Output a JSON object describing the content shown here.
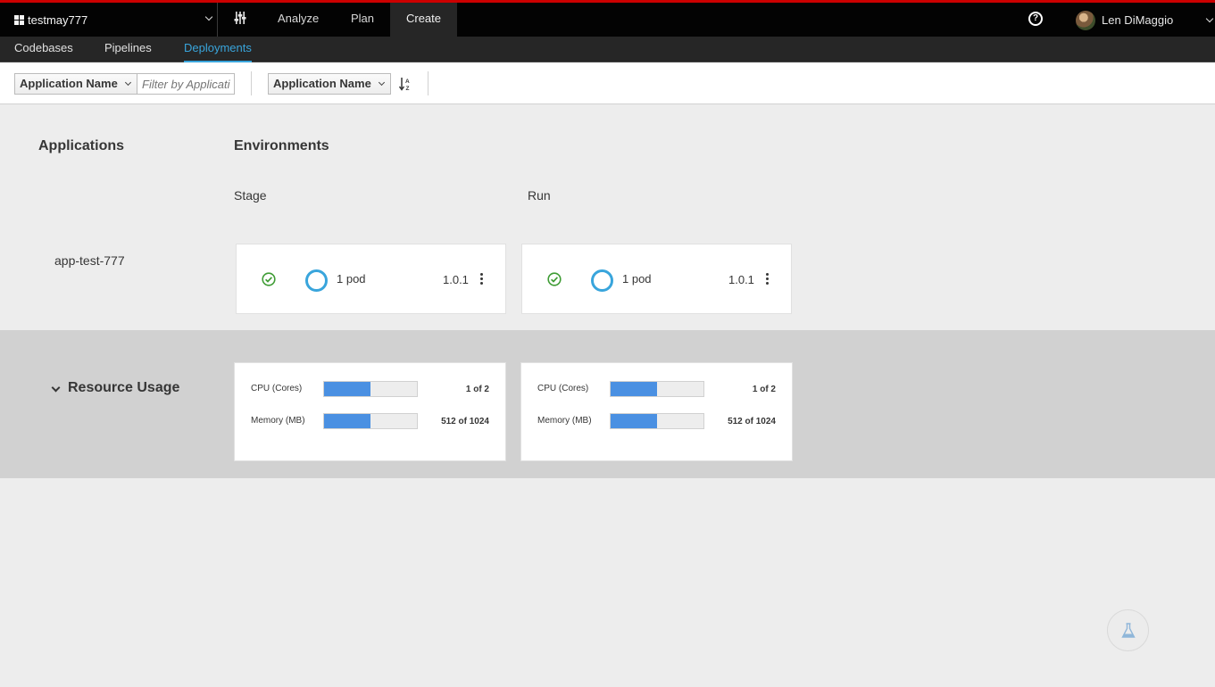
{
  "topnav": {
    "space_name": "testmay777",
    "items": [
      {
        "label": "Analyze"
      },
      {
        "label": "Plan"
      },
      {
        "label": "Create",
        "active": true
      }
    ],
    "help_glyph": "?",
    "user_name": "Len DiMaggio"
  },
  "subnav": {
    "items": [
      {
        "label": "Codebases"
      },
      {
        "label": "Pipelines"
      },
      {
        "label": "Deployments",
        "active": true
      }
    ]
  },
  "toolbar": {
    "filter_field_label": "Application Name",
    "filter_placeholder": "Filter by Applicati",
    "sort_field_label": "Application Name"
  },
  "main": {
    "applications_heading": "Applications",
    "environments_heading": "Environments",
    "environments": [
      {
        "name": "Stage",
        "pods": "1 pod",
        "version": "1.0.1"
      },
      {
        "name": "Run",
        "pods": "1 pod",
        "version": "1.0.1"
      }
    ],
    "applications": [
      {
        "name": "app-test-777"
      }
    ]
  },
  "resource_usage": {
    "title": "Resource Usage",
    "environments": [
      {
        "cpu_label": "CPU (Cores)",
        "cpu_value": "1 of 2",
        "cpu_fraction": 0.5,
        "mem_label": "Memory (MB)",
        "mem_value": "512 of 1024",
        "mem_fraction": 0.5
      },
      {
        "cpu_label": "CPU (Cores)",
        "cpu_value": "1 of 2",
        "cpu_fraction": 0.5,
        "mem_label": "Memory (MB)",
        "mem_value": "512 of 1024",
        "mem_fraction": 0.5
      }
    ]
  },
  "colors": {
    "accent": "#39a5dc",
    "bar_fill": "#4a90e2",
    "ok": "#3f9c35",
    "brand_red": "#cc0000"
  },
  "icons": {
    "space": "grid-icon",
    "settings": "sliders-icon",
    "help": "help-icon",
    "sort": "sort-alpha-icon",
    "status": "check-circle-icon",
    "menu": "kebab-icon",
    "feedback": "flask-icon"
  }
}
